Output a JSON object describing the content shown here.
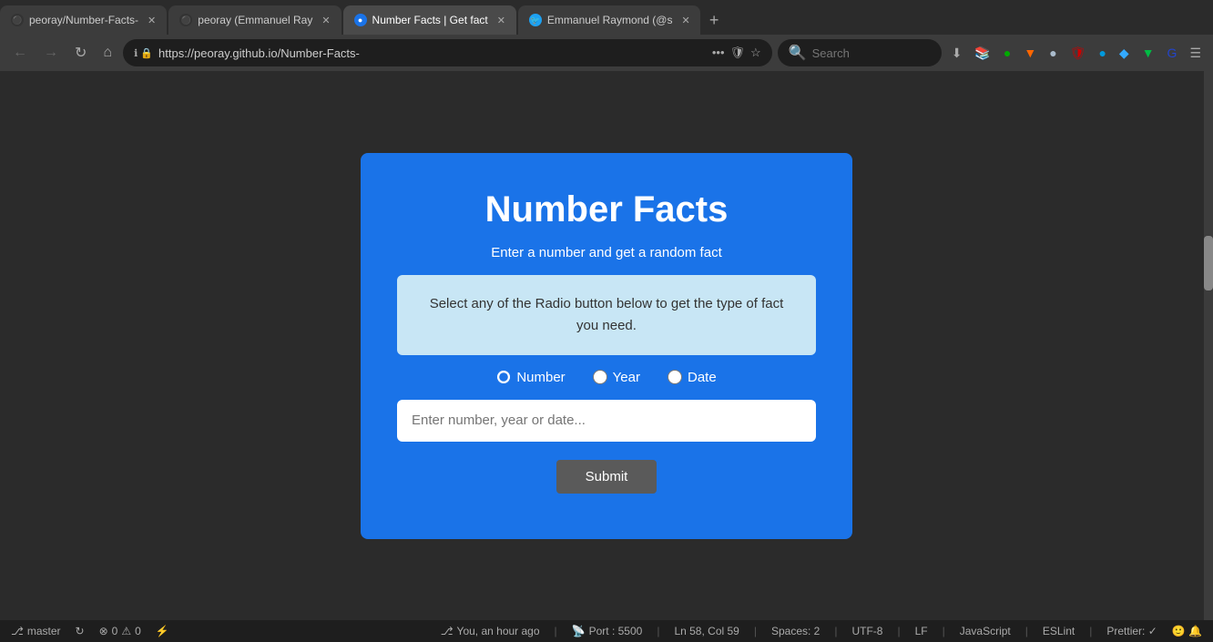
{
  "browser": {
    "tabs": [
      {
        "id": "tab-github-repo",
        "label": "peoray/Number-Facts-",
        "icon": "github",
        "active": false,
        "closable": true
      },
      {
        "id": "tab-github-user",
        "label": "peoray (Emmanuel Ray",
        "icon": "github",
        "active": false,
        "closable": true
      },
      {
        "id": "tab-app",
        "label": "Number Facts | Get fact",
        "icon": "page",
        "active": true,
        "closable": true
      },
      {
        "id": "tab-twitter",
        "label": "Emmanuel Raymond (@s",
        "icon": "twitter",
        "active": false,
        "closable": true
      }
    ],
    "new_tab_label": "+",
    "url": "https://peoray.github.io/Number-Facts-",
    "search_placeholder": "Search",
    "nav": {
      "back": "←",
      "forward": "→",
      "reload": "↻",
      "home": "⌂"
    }
  },
  "app": {
    "title": "Number Facts",
    "subtitle": "Enter a number and get a random fact",
    "info_text": "Select any of the Radio button below to get the type of fact you need.",
    "radio_options": [
      {
        "id": "radio-number",
        "label": "Number",
        "checked": true
      },
      {
        "id": "radio-year",
        "label": "Year",
        "checked": false
      },
      {
        "id": "radio-date",
        "label": "Date",
        "checked": false
      }
    ],
    "input_placeholder": "Enter number, year or date...",
    "submit_label": "Submit"
  },
  "status_bar": {
    "branch": "master",
    "sync_icon": "↻",
    "errors": "0",
    "warnings": "0",
    "lightning": "⚡",
    "git_icon": "⎇",
    "you_label": "You, an hour ago",
    "port": "Port : 5500",
    "ln_col": "Ln 58, Col 59",
    "spaces": "Spaces: 2",
    "encoding": "UTF-8",
    "line_ending": "LF",
    "language": "JavaScript",
    "eslint": "ESLint",
    "prettier": "Prettier: ✓",
    "notification_icons": "🙂 🔔"
  }
}
